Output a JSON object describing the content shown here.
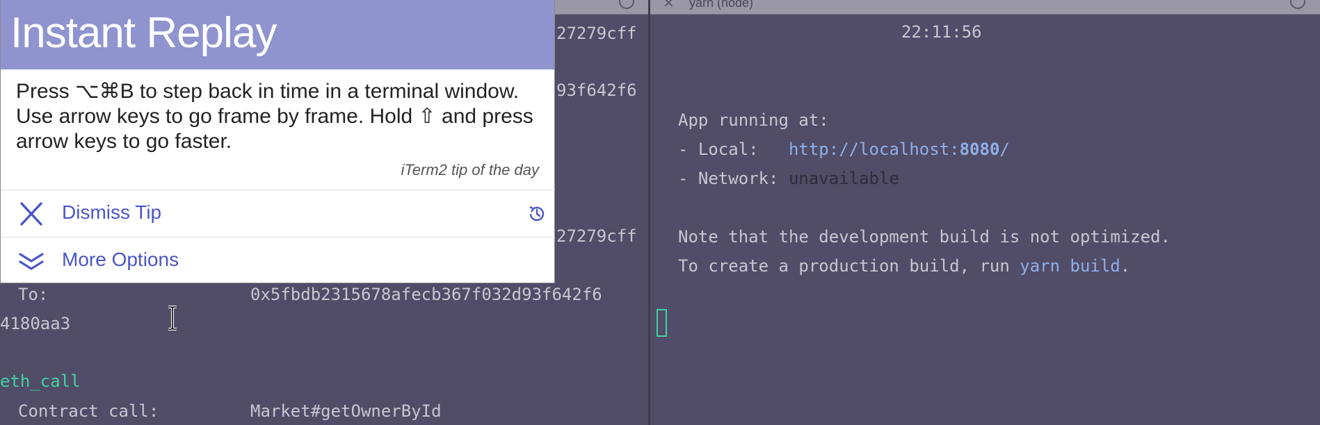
{
  "left_pane": {
    "lines": {
      "hash1": "27279cff",
      "hash2": "93f642f6",
      "hash3": "27279cff",
      "to_label": "To:",
      "to_value": "0x5fbdb2315678afecb367f032d93f642f6",
      "to_tail": "4180aa3",
      "eth_call": "eth_call",
      "contract_label": "Contract call:",
      "contract_value": "Market#getOwnerById"
    }
  },
  "right_pane": {
    "tab_title": "yarn (node)",
    "time": "22:11:56",
    "app_running": "App running at:",
    "local_label": "- Local:   ",
    "local_url_prefix": "http://localhost:",
    "local_url_port": "8080",
    "local_url_suffix": "/",
    "network_label": "- Network: ",
    "network_value": "unavailable",
    "note_line": "Note that the development build is not optimized.",
    "prod_line_prefix": "To create a production build, run ",
    "prod_cmd": "yarn build",
    "prod_line_suffix": "."
  },
  "tip": {
    "title": "Instant Replay",
    "body": "Press ⌥⌘B to step back in time in a terminal window. Use arrow keys to go frame by frame. Hold ⇧ and press arrow keys to go faster.",
    "source": "iTerm2 tip of the day",
    "dismiss_label": "Dismiss Tip",
    "more_label": "More Options"
  },
  "colors": {
    "accent": "#4a55c8",
    "tip_header": "#8f94cf",
    "terminal_bg": "#514c67",
    "link": "#8fb0e8",
    "green": "#3fd3a5"
  },
  "icons": [
    "close-icon",
    "history-icon",
    "chevron-double-down-icon",
    "tab-menu-icon",
    "text-cursor-icon"
  ]
}
